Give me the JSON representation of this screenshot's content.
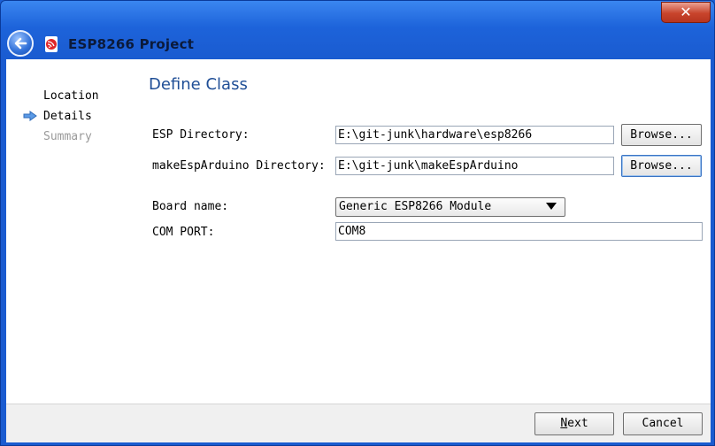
{
  "window": {
    "title": "ESP8266 Project",
    "close_label": "✕"
  },
  "nav": {
    "items": [
      {
        "label": "Location",
        "state": "normal"
      },
      {
        "label": "Details",
        "state": "current"
      },
      {
        "label": "Summary",
        "state": "disabled"
      }
    ]
  },
  "page": {
    "heading": "Define Class"
  },
  "form": {
    "esp_dir_label": "ESP Directory:",
    "esp_dir_value": "E:\\git-junk\\hardware\\esp8266",
    "make_dir_label": "makeEspArduino Directory:",
    "make_dir_value": "E:\\git-junk\\makeEspArduino",
    "browse_label": "Browse...",
    "board_label": "Board name:",
    "board_value": "Generic ESP8266 Module",
    "com_label": "COM PORT:",
    "com_value": "COM8"
  },
  "footer": {
    "next_underlined": "N",
    "next_rest": "ext",
    "cancel_label": "Cancel"
  },
  "colors": {
    "title_bar": "#1d63da",
    "heading": "#1f4e96",
    "close": "#c8442c"
  }
}
